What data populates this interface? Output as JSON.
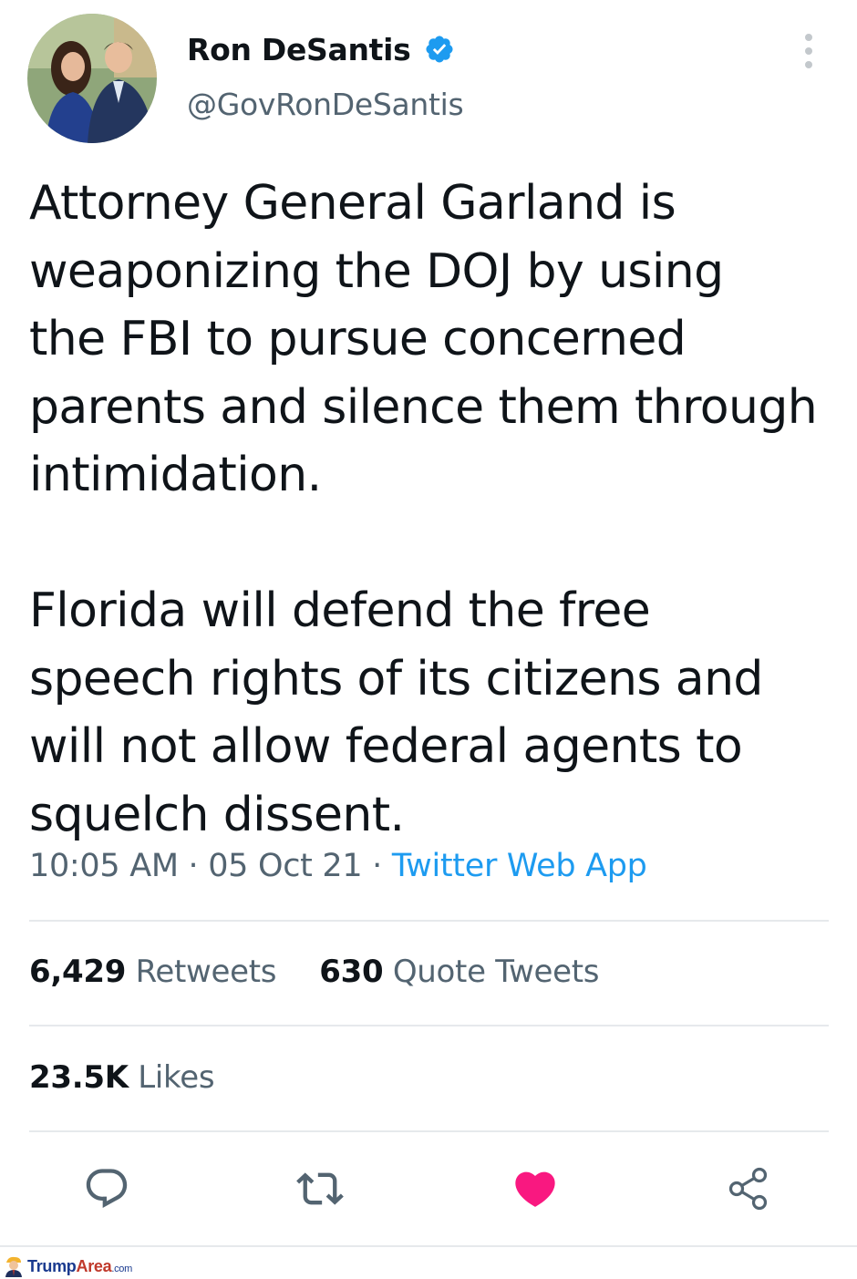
{
  "author": {
    "name": "Ron DeSantis",
    "handle": "@GovRonDeSantis",
    "verified": true
  },
  "tweet": {
    "text": "Attorney General Garland is\nweaponizing the DOJ by using\nthe FBI to pursue concerned\nparents and silence them through\nintimidation.\n\nFlorida will defend the free\nspeech rights of its citizens and\nwill not allow federal agents to\nsquelch dissent.",
    "time": "10:05 AM",
    "date": "05 Oct 21",
    "separator": " · ",
    "source": "Twitter Web App"
  },
  "stats": {
    "retweets_count": "6,429",
    "retweets_label": "Retweets",
    "quotes_count": "630",
    "quotes_label": "Quote Tweets",
    "likes_count": "23.5K",
    "likes_label": "Likes"
  },
  "actions": [
    {
      "name": "reply-icon"
    },
    {
      "name": "retweet-icon"
    },
    {
      "name": "like-icon",
      "liked": true
    },
    {
      "name": "share-icon"
    }
  ],
  "colors": {
    "accent": "#1d9bf0",
    "like": "#f91880",
    "secondary_text": "#536471"
  },
  "watermark": {
    "part1": "Trump",
    "part2": "Area",
    "part3": ".com"
  }
}
